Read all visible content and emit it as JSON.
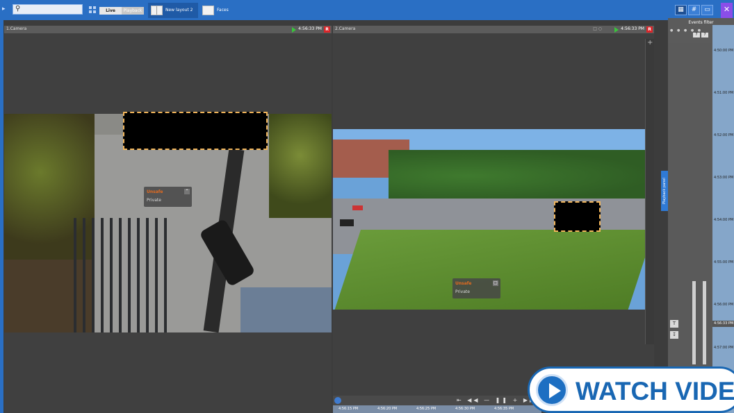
{
  "toolbar": {
    "search_placeholder": "",
    "mode_live": "Live",
    "mode_playback": "Playback",
    "tabs": [
      {
        "label": "New layout 2"
      },
      {
        "label": "Faces"
      }
    ]
  },
  "cameras": [
    {
      "title": "1.Camera",
      "time": "4:56:33 PM",
      "rec": "R",
      "overlay": {
        "name": "Unsafe",
        "label": "Private"
      }
    },
    {
      "title": "2.Camera",
      "time": "4:56:33 PM",
      "rec": "R",
      "overlay": {
        "name": "Unsafe",
        "label": "Private"
      }
    }
  ],
  "timeline": {
    "ticks": [
      "4:56:15 PM",
      "4:56:20 PM",
      "4:56:25 PM",
      "4:56:30 PM",
      "4:56:35 PM"
    ]
  },
  "events_panel": {
    "title": "Events filter",
    "tab": "Playback panel",
    "counts": [
      "7",
      "7"
    ],
    "times": [
      "4:50:00 PM",
      "4:51:00 PM",
      "4:52:00 PM",
      "4:53:00 PM",
      "4:54:00 PM",
      "4:55:00 PM",
      "4:56:00 PM",
      "4:57:00 PM"
    ],
    "current_time": "4:56:33 PM"
  },
  "watch_video": {
    "label": "WATCH VIDEO"
  }
}
